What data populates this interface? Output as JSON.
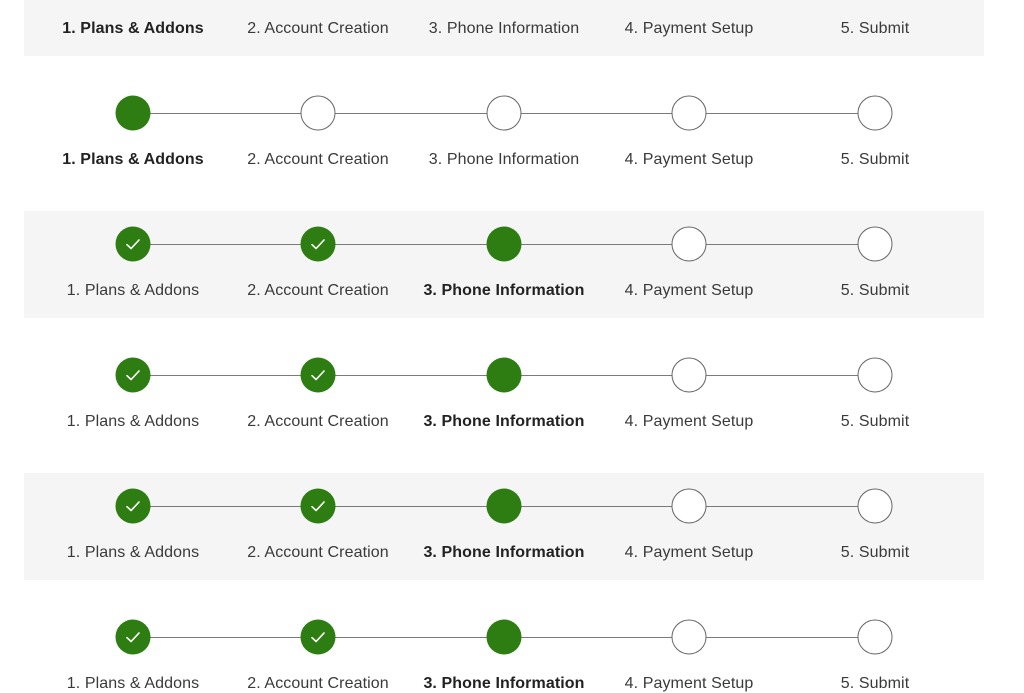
{
  "step_labels": [
    "1. Plans & Addons",
    "2. Account Creation",
    "3. Phone Information",
    "4. Payment Setup",
    "5. Submit"
  ],
  "colors": {
    "complete": "#2e7d12",
    "band_background": "#f5f5f5",
    "track": "#7a7a7a"
  },
  "header": {
    "active_step": 1
  },
  "steppers": [
    {
      "shaded": false,
      "active_step": 1,
      "states": [
        "current",
        "todo",
        "todo",
        "todo",
        "todo"
      ]
    },
    {
      "shaded": true,
      "active_step": 3,
      "states": [
        "done",
        "done",
        "current",
        "todo",
        "todo"
      ]
    },
    {
      "shaded": false,
      "active_step": 3,
      "states": [
        "done",
        "done",
        "current",
        "todo",
        "todo"
      ]
    },
    {
      "shaded": true,
      "active_step": 3,
      "states": [
        "done",
        "done",
        "current",
        "todo",
        "todo"
      ]
    },
    {
      "shaded": false,
      "active_step": 3,
      "states": [
        "done",
        "done",
        "current",
        "todo",
        "todo"
      ]
    }
  ]
}
